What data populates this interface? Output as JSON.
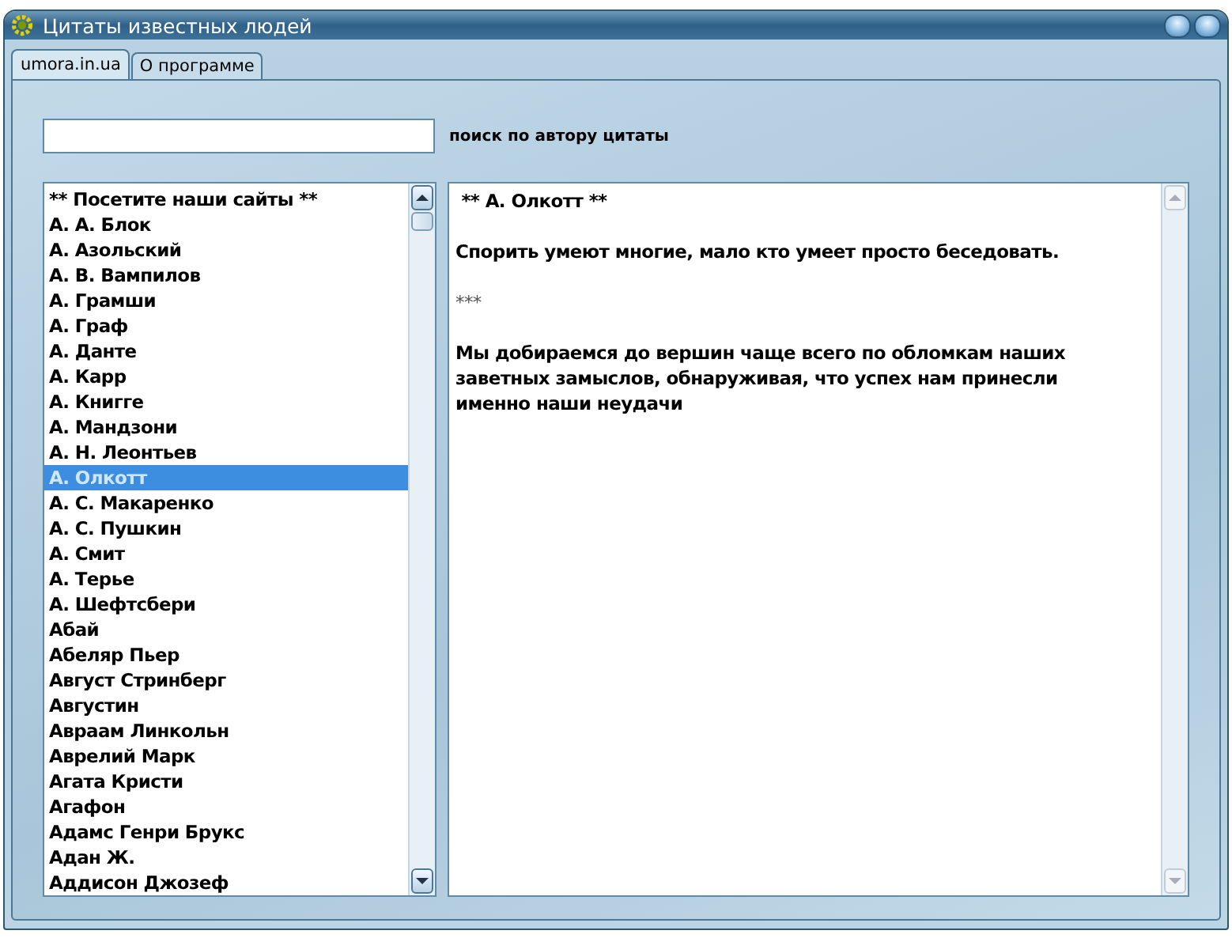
{
  "window": {
    "title": "Цитаты известных людей"
  },
  "tabs": [
    {
      "label": "umora.in.ua",
      "selected": true
    },
    {
      "label": "О программе",
      "selected": false
    }
  ],
  "search": {
    "label": "поиск по автору цитаты"
  },
  "authors": [
    {
      "name": "** Посетите наши сайты **",
      "selected": false
    },
    {
      "name": "А. А. Блок",
      "selected": false
    },
    {
      "name": "А. Азольский",
      "selected": false
    },
    {
      "name": "А. В. Вампилов",
      "selected": false
    },
    {
      "name": "А. Грамши",
      "selected": false
    },
    {
      "name": "А. Граф",
      "selected": false
    },
    {
      "name": "А. Данте",
      "selected": false
    },
    {
      "name": "А. Карр",
      "selected": false
    },
    {
      "name": "А. Книгге",
      "selected": false
    },
    {
      "name": "А. Мандзони",
      "selected": false
    },
    {
      "name": "А. Н. Леонтьев",
      "selected": false
    },
    {
      "name": "А. Олкотт",
      "selected": true
    },
    {
      "name": "А. С. Макаренко",
      "selected": false
    },
    {
      "name": "А. С. Пушкин",
      "selected": false
    },
    {
      "name": "А. Смит",
      "selected": false
    },
    {
      "name": "А. Терье",
      "selected": false
    },
    {
      "name": "А. Шефтсбери",
      "selected": false
    },
    {
      "name": "Абай",
      "selected": false
    },
    {
      "name": "Абеляр Пьер",
      "selected": false
    },
    {
      "name": "Август Стринберг",
      "selected": false
    },
    {
      "name": "Августин",
      "selected": false
    },
    {
      "name": "Авраам Линкольн",
      "selected": false
    },
    {
      "name": "Аврелий Марк",
      "selected": false
    },
    {
      "name": "Агата Кристи",
      "selected": false
    },
    {
      "name": "Агафон",
      "selected": false
    },
    {
      "name": "Адамс Генри Брукс",
      "selected": false
    },
    {
      "name": "Адан Ж.",
      "selected": false
    },
    {
      "name": "Аддисон Джозеф",
      "selected": false
    }
  ],
  "quotes": {
    "heading": " ** А. Олкотт **",
    "paragraphs": [
      {
        "kind": "quote",
        "text": "Спорить умеют многие, мало кто умеет просто беседовать."
      },
      {
        "kind": "separator",
        "text": "***"
      },
      {
        "kind": "quote",
        "text": "Мы добираемся до вершин чаще всего по обломкам наших заветных замыслов, обнаруживая, что успех нам принесли именно наши неудачи"
      }
    ]
  }
}
